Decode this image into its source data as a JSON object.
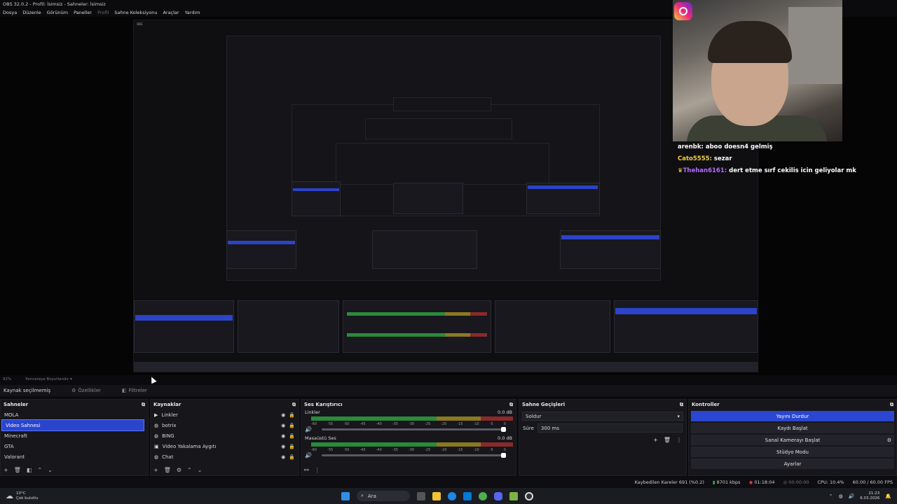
{
  "window": {
    "title": "OBS 32.0.2 - Profil: İsimsiz - Sahneler: İsimsiz"
  },
  "menu": [
    "Dosya",
    "Düzenle",
    "Görünüm",
    "Paneller",
    "Profil",
    "Sahne Koleksiyonu",
    "Araçlar",
    "Yardım"
  ],
  "preview": {
    "zoom": "92%",
    "fit_label": "Pencereye Boyutlandır"
  },
  "chat": [
    {
      "user": "arenbk:",
      "message": "aboo doesn4 gelmiş",
      "user_color": "#ffffff"
    },
    {
      "user": "Cato5555:",
      "message": "sezar",
      "user_color": "#f4d03f"
    },
    {
      "user": "Thehan6161:",
      "message": "dert etme sırf cekilis icin geliyolar mk",
      "user_color": "#b36bff"
    }
  ],
  "source_bar": {
    "title": "Kaynak seçilmemiş",
    "properties": "Özellikler",
    "filters": "Filtreler"
  },
  "scenes": {
    "title": "Sahneler",
    "items": [
      "MOLA",
      "Video Sahnesi",
      "Minecraft",
      "GTA",
      "Valorant"
    ],
    "selected": 1
  },
  "sources": {
    "title": "Kaynaklar",
    "items": [
      {
        "label": "Linkler",
        "icon": "play-icon"
      },
      {
        "label": "botrix",
        "icon": "globe-icon"
      },
      {
        "label": "BING",
        "icon": "globe-icon"
      },
      {
        "label": "Video Yakalama Aygıtı",
        "icon": "camera-icon"
      },
      {
        "label": "Chat",
        "icon": "globe-icon"
      }
    ]
  },
  "mixer": {
    "title": "Ses Karıştırıcı",
    "channels": [
      {
        "name": "Linkler",
        "db": "0.0 dB"
      },
      {
        "name": "Masaüstü Ses",
        "db": "0.0 dB"
      }
    ],
    "ticks": [
      "-60",
      "-55",
      "-50",
      "-45",
      "-40",
      "-35",
      "-30",
      "-25",
      "-20",
      "-15",
      "-10",
      "-5",
      "0"
    ]
  },
  "transitions": {
    "title": "Sahne Geçişleri",
    "selected": "Soldur",
    "duration_label": "Süre",
    "duration": "300 ms"
  },
  "controls": {
    "title": "Kontroller",
    "buttons": [
      "Yayını Durdur",
      "Kaydı Başlat",
      "Sanal Kamerayı Başlat",
      "Stüdyo Modu",
      "Ayarlar"
    ]
  },
  "status": {
    "dropped": "Kaybedilen Kareler 691 (%0.2)",
    "bitrate": "8701 kbps",
    "stream_time": "01:18:04",
    "rec_time": "00:00:00",
    "cpu": "CPU: 10.4%",
    "fps": "60.00 / 60.00 FPS"
  },
  "taskbar": {
    "weather_temp": "10°C",
    "weather_desc": "Çok bulutlu",
    "search": "Ara",
    "time": "21:23",
    "date": "6.03.2026"
  },
  "colors": {
    "accent": "#2b46d0",
    "background": "#16161b"
  }
}
